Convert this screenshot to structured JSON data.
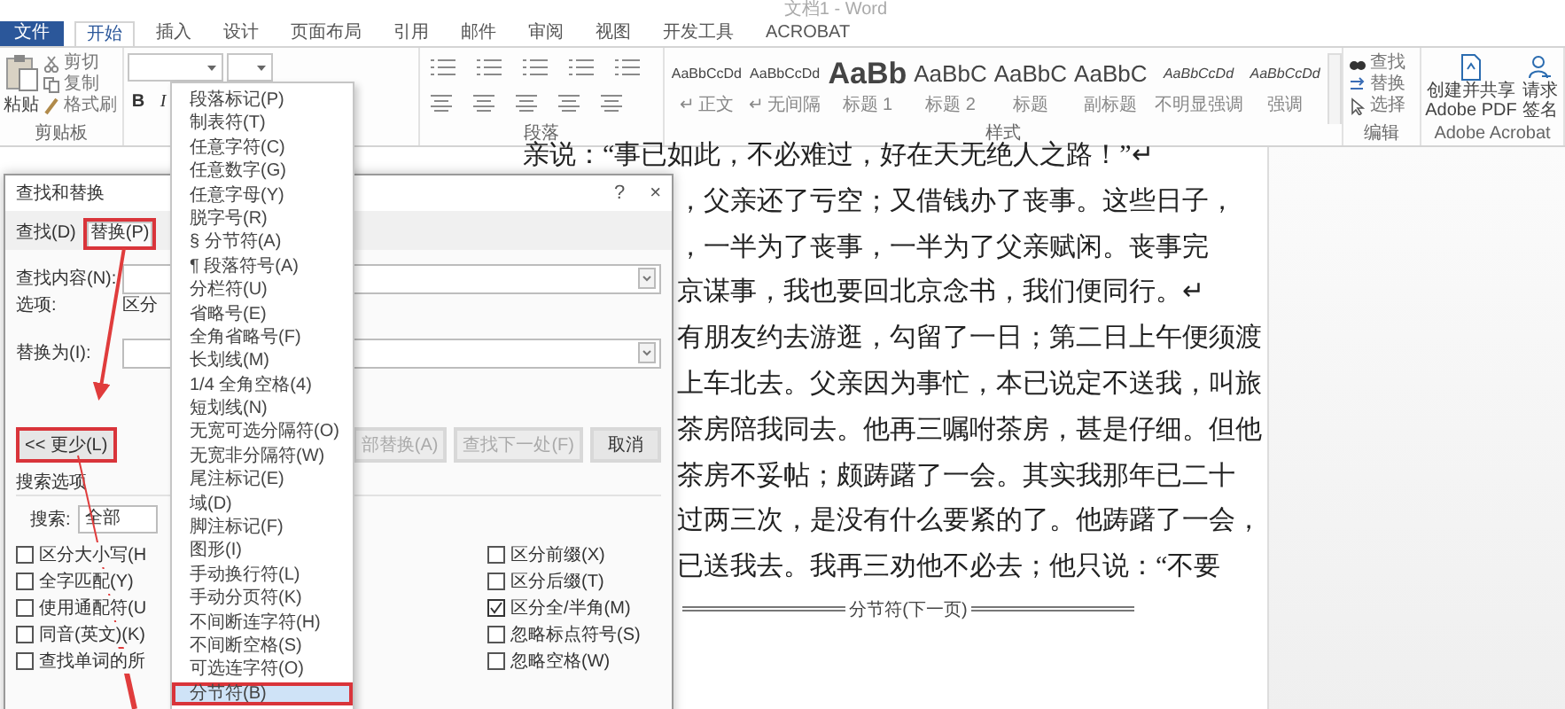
{
  "window": {
    "title": "文档1 - Word"
  },
  "ribbon_tabs": [
    {
      "label": "文件",
      "kind": "file",
      "selected": false
    },
    {
      "label": "开始",
      "kind": "tab",
      "selected": true
    },
    {
      "label": "插入",
      "kind": "tab",
      "selected": false
    },
    {
      "label": "设计",
      "kind": "tab",
      "selected": false
    },
    {
      "label": "页面布局",
      "kind": "tab",
      "selected": false
    },
    {
      "label": "引用",
      "kind": "tab",
      "selected": false
    },
    {
      "label": "邮件",
      "kind": "tab",
      "selected": false
    },
    {
      "label": "审阅",
      "kind": "tab",
      "selected": false
    },
    {
      "label": "视图",
      "kind": "tab",
      "selected": false
    },
    {
      "label": "开发工具",
      "kind": "tab",
      "selected": false
    },
    {
      "label": "ACROBAT",
      "kind": "tab",
      "selected": false
    }
  ],
  "clipboard": {
    "paste": "粘贴",
    "actions": [
      "剪切",
      "复制",
      "格式刷"
    ],
    "group": "剪贴板"
  },
  "font": {
    "buttons": [
      "B",
      "I"
    ]
  },
  "paragraph": {
    "group": "段落"
  },
  "styles": {
    "items": [
      {
        "sample": "AaBbCcDd",
        "name": "↵ 正文",
        "kind": "plain"
      },
      {
        "sample": "AaBbCcDd",
        "name": "↵ 无间隔",
        "kind": "plain"
      },
      {
        "sample": "AaBb",
        "name": "标题 1",
        "kind": "large"
      },
      {
        "sample": "AaBbC",
        "name": "标题 2",
        "kind": "medium"
      },
      {
        "sample": "AaBbC",
        "name": "标题",
        "kind": "medium"
      },
      {
        "sample": "AaBbC",
        "name": "副标题",
        "kind": "medium"
      },
      {
        "sample": "AaBbCcDd",
        "name": "不明显强调",
        "kind": "emphasis"
      },
      {
        "sample": "AaBbCcDd",
        "name": "强调",
        "kind": "emphasis"
      }
    ],
    "group": "样式"
  },
  "editing": {
    "items": [
      {
        "label": "查找",
        "kind": "find"
      },
      {
        "label": "替换",
        "kind": "replace"
      },
      {
        "label": "选择",
        "kind": "select"
      }
    ],
    "group": "编辑"
  },
  "acrobat": {
    "buttons": [
      {
        "label": "创建并共享 Adobe PDF",
        "kind": "pdf"
      },
      {
        "label": "请求签名",
        "kind": "sign"
      }
    ],
    "group": "Adobe Acrobat"
  },
  "document": {
    "lines": [
      {
        "text": "亲说：“事已如此，不必难过，好在天无绝人之路！”↵",
        "kind": "open"
      },
      {
        "text": "，父亲还了亏空；又借钱办了丧事。这些日子，",
        "kind": "behind_dialog"
      },
      {
        "text": "，一半为了丧事，一半为了父亲赋闲。丧事完",
        "kind": "behind_dialog"
      },
      {
        "text": "京谋事，我也要回北京念书，我们便同行。↵",
        "kind": "behind_dialog"
      },
      {
        "text": "有朋友约去游逛，勾留了一日；第二日上午便须渡",
        "kind": "behind_dialog"
      },
      {
        "text": "上车北去。父亲因为事忙，本已说定不送我，叫旅",
        "kind": "behind_dialog"
      },
      {
        "text": "茶房陪我同去。他再三嘱咐茶房，甚是仔细。但他",
        "kind": "behind_dialog"
      },
      {
        "text": "茶房不妥帖；颇踌躇了一会。其实我那年已二十",
        "kind": "behind_dialog"
      },
      {
        "text": "过两三次，是没有什么要紧的了。他踌躇了一会，",
        "kind": "behind_dialog"
      },
      {
        "text": "已送我去。我再三劝他不必去；他只说：“不要",
        "kind": "behind_dialog"
      }
    ],
    "section_break": "分节符(下一页)"
  },
  "dialog": {
    "title": "查找和替换",
    "help": "?",
    "close": "×",
    "tabs": [
      {
        "label": "查找(D)",
        "selected": false,
        "highlighted": false
      },
      {
        "label": "替换(P)",
        "selected": true,
        "highlighted": true
      }
    ],
    "fields": [
      {
        "label": "查找内容(N):",
        "kind": "input"
      },
      {
        "label": "选项:",
        "kind": "text",
        "value": "区分"
      },
      {
        "label": "替换为(I):",
        "kind": "input"
      }
    ],
    "buttons": [
      {
        "label": "<< 更少(L)",
        "disabled": false,
        "highlighted": true
      },
      {
        "label": "部替换(A)",
        "disabled": true,
        "highlighted": false
      },
      {
        "label": "查找下一处(F)",
        "disabled": true,
        "highlighted": false
      },
      {
        "label": "取消",
        "disabled": false,
        "highlighted": false
      }
    ],
    "search_options": "搜索选项",
    "search": {
      "label": "搜索:",
      "value": "全部"
    },
    "checkboxes_left": [
      {
        "label": "区分大小写(H",
        "checked": false
      },
      {
        "label": "全字匹配(Y)",
        "checked": false
      },
      {
        "label": "使用通配符(U",
        "checked": false
      },
      {
        "label": "同音(英文)(K)",
        "checked": false
      },
      {
        "label": "查找单词的所",
        "checked": false
      }
    ],
    "checkboxes_right": [
      {
        "label": "区分前缀(X)",
        "checked": false
      },
      {
        "label": "区分后缀(T)",
        "checked": false
      },
      {
        "label": "区分全/半角(M)",
        "checked": true
      },
      {
        "label": "忽略标点符号(S)",
        "checked": false
      },
      {
        "label": "忽略空格(W)",
        "checked": false
      }
    ]
  },
  "menu": {
    "items": [
      {
        "label": "段落标记(P)",
        "selected": false,
        "highlighted": false
      },
      {
        "label": "制表符(T)",
        "selected": false,
        "highlighted": false
      },
      {
        "label": "任意字符(C)",
        "selected": false,
        "highlighted": false
      },
      {
        "label": "任意数字(G)",
        "selected": false,
        "highlighted": false
      },
      {
        "label": "任意字母(Y)",
        "selected": false,
        "highlighted": false
      },
      {
        "label": "脱字号(R)",
        "selected": false,
        "highlighted": false
      },
      {
        "label": "§ 分节符(A)",
        "selected": false,
        "highlighted": false
      },
      {
        "label": "¶ 段落符号(A)",
        "selected": false,
        "highlighted": false
      },
      {
        "label": "分栏符(U)",
        "selected": false,
        "highlighted": false
      },
      {
        "label": "省略号(E)",
        "selected": false,
        "highlighted": false
      },
      {
        "label": "全角省略号(F)",
        "selected": false,
        "highlighted": false
      },
      {
        "label": "长划线(M)",
        "selected": false,
        "highlighted": false
      },
      {
        "label": "1/4 全角空格(4)",
        "selected": false,
        "highlighted": false
      },
      {
        "label": "短划线(N)",
        "selected": false,
        "highlighted": false
      },
      {
        "label": "无宽可选分隔符(O)",
        "selected": false,
        "highlighted": false
      },
      {
        "label": "无宽非分隔符(W)",
        "selected": false,
        "highlighted": false
      },
      {
        "label": "尾注标记(E)",
        "selected": false,
        "highlighted": false
      },
      {
        "label": "域(D)",
        "selected": false,
        "highlighted": false
      },
      {
        "label": "脚注标记(F)",
        "selected": false,
        "highlighted": false
      },
      {
        "label": "图形(I)",
        "selected": false,
        "highlighted": false
      },
      {
        "label": "手动换行符(L)",
        "selected": false,
        "highlighted": false
      },
      {
        "label": "手动分页符(K)",
        "selected": false,
        "highlighted": false
      },
      {
        "label": "不间断连字符(H)",
        "selected": false,
        "highlighted": false
      },
      {
        "label": "不间断空格(S)",
        "selected": false,
        "highlighted": false
      },
      {
        "label": "可选连字符(O)",
        "selected": false,
        "highlighted": false
      },
      {
        "label": "分节符(B)",
        "selected": true,
        "highlighted": true
      }
    ]
  }
}
